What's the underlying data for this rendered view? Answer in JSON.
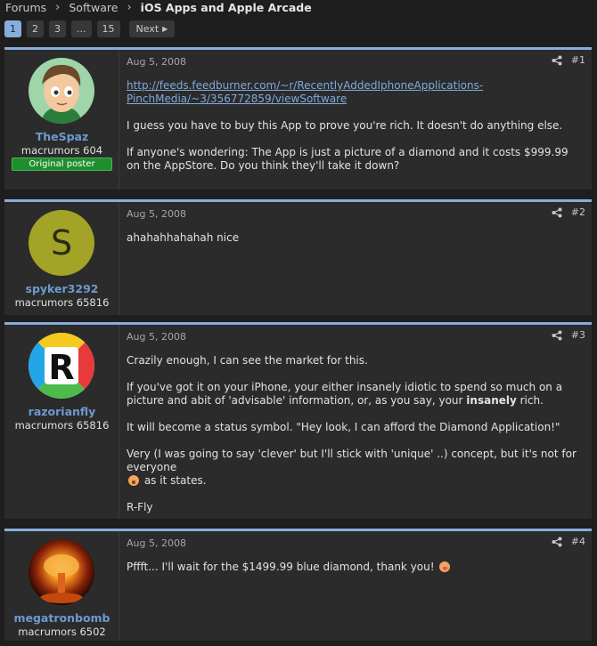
{
  "breadcrumb": {
    "items": [
      "Forums",
      "Software"
    ],
    "current": "iOS Apps and Apple Arcade"
  },
  "pager": {
    "pages": [
      "1",
      "2",
      "3",
      "...",
      "15"
    ],
    "active": "1",
    "next_label": "Next"
  },
  "colors": {
    "accent": "#87aedb",
    "username": "#6d9ad0",
    "op_badge": "#1f8f2e"
  },
  "posts": [
    {
      "username": "TheSpaz",
      "user_title": "macrumors 604",
      "badge": "Original poster",
      "avatar": "cartoon-face-avatar",
      "date": "Aug 5, 2008",
      "number": "#1",
      "link_line1": "http://feeds.feedburner.com/~r/RecentlyAddedIphoneApplications-",
      "link_line2": "PinchMedia/~3/356772859/viewSoftware",
      "p1": "I guess you have to buy this App to prove you're rich. It doesn't do anything else.",
      "p2": "If anyone's wondering: The App is just a picture of a diamond and it costs $999.99 on the AppStore. Do you think they'll take it down?"
    },
    {
      "username": "spyker3292",
      "user_title": "macrumors 65816",
      "avatar_letter": "S",
      "date": "Aug 5, 2008",
      "number": "#2",
      "p1": "ahahahhahahah nice"
    },
    {
      "username": "razorianfly",
      "user_title": "macrumors 65816",
      "avatar": "r-logo-avatar",
      "date": "Aug 5, 2008",
      "number": "#3",
      "p1": "Crazily enough, I can see the market for this.",
      "p2a": "If you've got it on your iPhone, your either insanely idiotic to spend so much on a picture and abit of 'advisable' information, or, as you say, your ",
      "p2b": "insanely",
      "p2c": " rich.",
      "p3": "It will become a status symbol. \"Hey look, I can afford the Diamond Application!\"",
      "p4a": "Very (I was going to say 'clever' but I'll stick with 'unique' ..) concept, but it's not for everyone",
      "p4b": " as it states.",
      "p5": "R-Fly"
    },
    {
      "username": "megatronbomb",
      "user_title": "macrumors 6502",
      "avatar": "explosion-avatar",
      "date": "Aug 5, 2008",
      "number": "#4",
      "p1": "Pffft... I'll wait for the $1499.99 blue diamond, thank you!"
    }
  ]
}
